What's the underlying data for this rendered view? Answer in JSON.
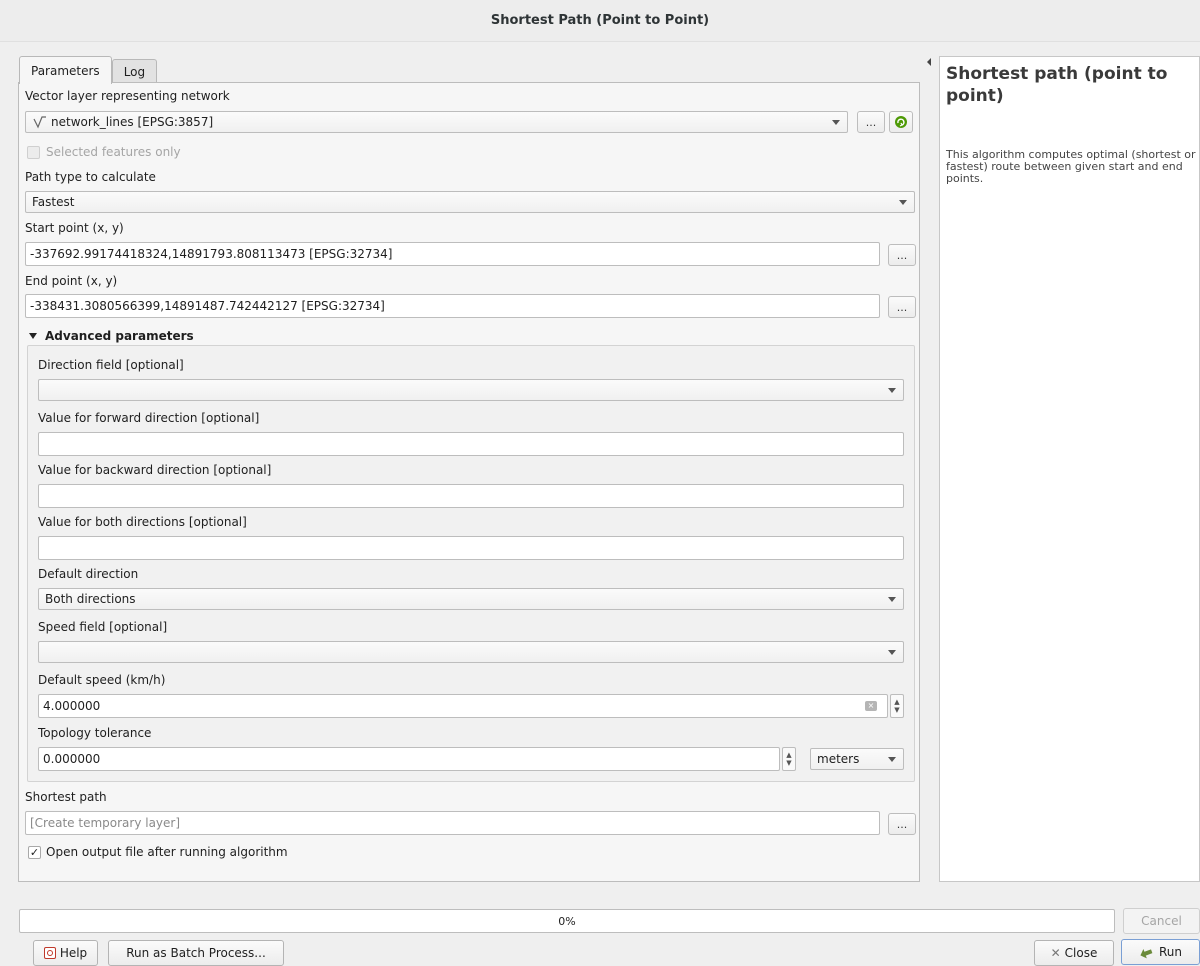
{
  "window": {
    "title": "Shortest Path (Point to Point)"
  },
  "tabs": [
    {
      "label": "Parameters"
    },
    {
      "label": "Log"
    }
  ],
  "params": {
    "network_label": "Vector layer representing network",
    "network_value": "network_lines [EPSG:3857]",
    "network_icon": "line-layer-icon",
    "browse_label": "...",
    "selected_only_label": "Selected features only",
    "path_type_label": "Path type to calculate",
    "path_type_value": "Fastest",
    "start_label": "Start point (x, y)",
    "start_value": "-337692.99174418324,14891793.808113473 [EPSG:32734]",
    "end_label": "End point (x, y)",
    "end_value": "-338431.3080566399,14891487.742442127 [EPSG:32734]",
    "advanced_label": "Advanced parameters",
    "direction_field_label": "Direction field [optional]",
    "direction_field_value": "",
    "forward_label": "Value for forward direction [optional]",
    "forward_value": "",
    "backward_label": "Value for backward direction [optional]",
    "backward_value": "",
    "both_label": "Value for both directions [optional]",
    "both_value": "",
    "default_direction_label": "Default direction",
    "default_direction_value": "Both directions",
    "speed_field_label": "Speed field [optional]",
    "speed_field_value": "",
    "default_speed_label": "Default speed (km/h)",
    "default_speed_value": "4.000000",
    "tolerance_label": "Topology tolerance",
    "tolerance_value": "0.000000",
    "tolerance_unit": "meters",
    "output_label": "Shortest path",
    "output_placeholder": "[Create temporary layer]",
    "open_output_label": "Open output file after running algorithm",
    "open_output_checked": true
  },
  "help": {
    "title": "Shortest path (point to point)",
    "text": "This algorithm computes optimal (shortest or fastest) route between given start and end points."
  },
  "progress": {
    "value": "0%"
  },
  "buttons": {
    "cancel": "Cancel",
    "help": "Help",
    "batch": "Run as Batch Process...",
    "close": "Close",
    "run": "Run"
  }
}
